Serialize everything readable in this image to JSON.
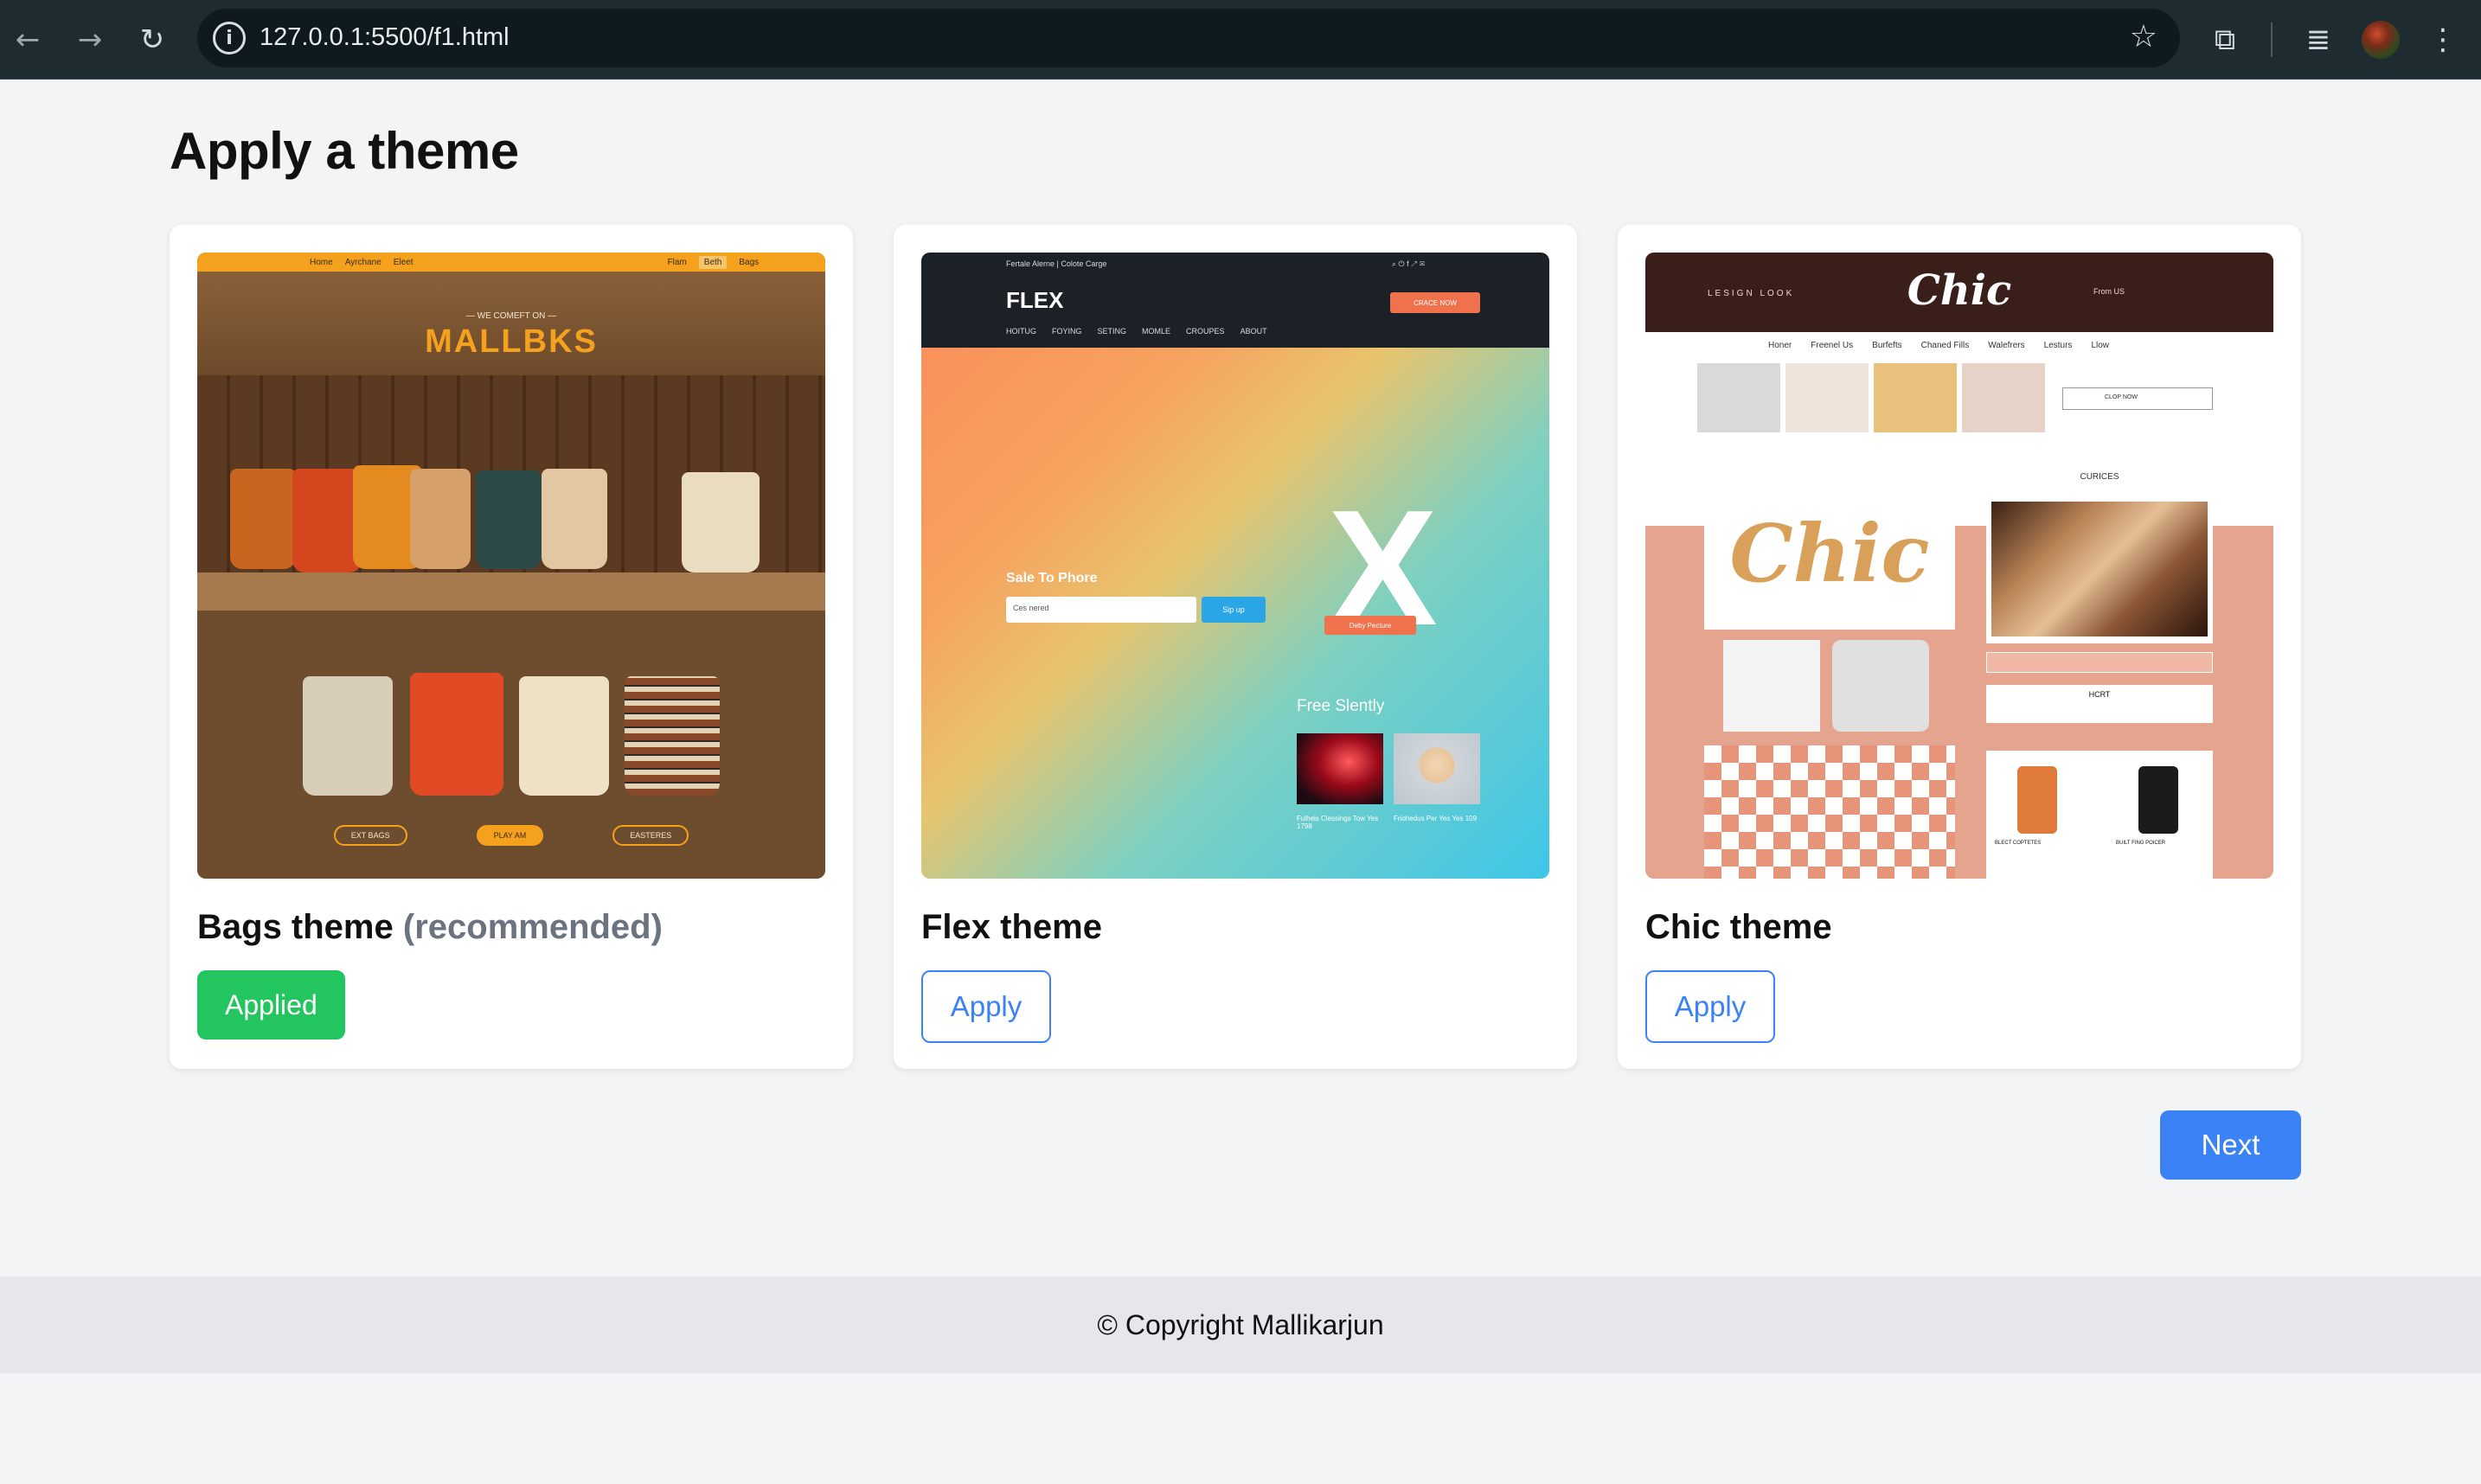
{
  "browser": {
    "url": "127.0.0.1:5500/f1.html",
    "icons": [
      "back-icon",
      "forward-icon",
      "reload-icon",
      "info-icon",
      "star-icon",
      "extensions-icon",
      "media-icon",
      "avatar",
      "menu-icon"
    ]
  },
  "page": {
    "title": "Apply a theme"
  },
  "themes": [
    {
      "name": "Bags theme",
      "tag": "(recommended)",
      "button": "Applied",
      "state": "applied"
    },
    {
      "name": "Flex theme",
      "tag": "",
      "button": "Apply",
      "state": "available"
    },
    {
      "name": "Chic theme",
      "tag": "",
      "button": "Apply",
      "state": "available"
    }
  ],
  "thumbnails": {
    "bags": {
      "nav": [
        "Home",
        "Ayrchane",
        "Eleet",
        "Flam",
        "Beth",
        "Bags"
      ],
      "tagline": "— WE COMEFT ON —",
      "brand": "MALLBKS",
      "pills": [
        "EXT BAGS",
        "PLAY AM",
        "EASTERES"
      ]
    },
    "flex": {
      "top": "Fertale Alerne  |  Colote Carge",
      "logo": "FLEX",
      "cta": "CRACE NOW",
      "nav": [
        "HOITUG",
        "FOYING",
        "SETING",
        "MOMLE",
        "CROUPES",
        "ABOUT"
      ],
      "sale": "Sale To Phore",
      "input": "Ces nered",
      "signup": "Sip up",
      "badge": "Deby Pecture",
      "free": "Free Slently",
      "cap1": "Fulhels Clessings Tow Yes 1798",
      "cap2": "Friohedus Per Yes Yes 109"
    },
    "chic": {
      "lesign": "LESIGN LOOK",
      "logo": "Chic",
      "right": "From US",
      "links": [
        "Honer",
        "Freenel Us",
        "Burfefts",
        "Chaned Fills",
        "Walefrers",
        "Lesturs",
        "Llow"
      ],
      "search": "CLOP NOW",
      "curices": "CURICES",
      "hcrt": "HCRT",
      "p1": "BLECT COPTETES",
      "p2": "BUILT FING POICER"
    }
  },
  "actions": {
    "next": "Next"
  },
  "footer": {
    "text": "© Copyright Mallikarjun"
  }
}
